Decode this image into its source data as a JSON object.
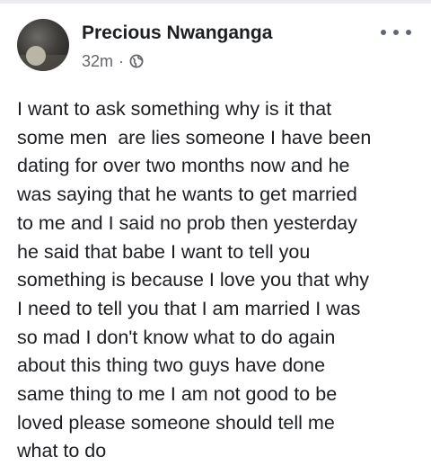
{
  "post": {
    "author_name": "Precious Nwanganga",
    "timestamp": "32m",
    "separator": "·",
    "privacy_icon": "globe-icon",
    "more_icon": "more-horizontal-icon",
    "body_lines": [
      "I want to ask something why is it that",
      "some men  are lies someone I have been",
      "dating for over two months now and he",
      "was saying that he wants to get married",
      "to me and I said no prob then yesterday",
      "he said that babe I want to tell you",
      "something is because I love you that why",
      "I need to tell you that I am married I was",
      "so mad I don't know what to do again",
      "about this thing two guys have done",
      "same thing to me I am not good to be",
      "loved please someone should tell me",
      "what to do"
    ]
  },
  "colors": {
    "text_primary": "#1c1e21",
    "text_secondary": "#65676b",
    "background": "#ffffff"
  }
}
